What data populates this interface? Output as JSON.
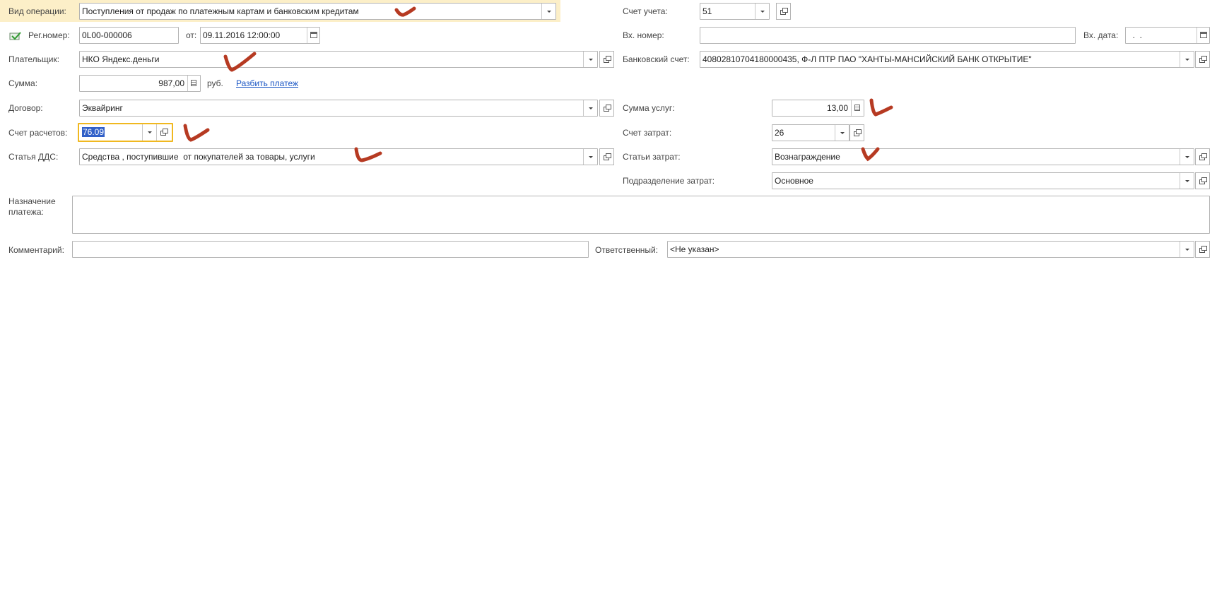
{
  "colors": {
    "highlight_row": "#fcefc8",
    "focus_border": "#f0b820",
    "link": "#1a56c4",
    "annotation": "#b63a22",
    "selection": "#3160c8"
  },
  "header": {
    "operation_label": "Вид операции:",
    "operation_value": "Поступления от продаж по платежным картам и банковским кредитам",
    "account_label": "Счет учета:",
    "account_value": "51"
  },
  "reg": {
    "number_label": "Рег.номер:",
    "number_value": "0L00-000006",
    "date_label": "от:",
    "date_value": "09.11.2016 12:00:00",
    "in_number_label": "Вх. номер:",
    "in_number_value": "",
    "in_date_label": "Вх. дата:",
    "in_date_value": "  .  .    "
  },
  "payer": {
    "label": "Плательщик:",
    "value": "НКО Яндекс.деньги",
    "bank_label": "Банковский счет:",
    "bank_value": "40802810704180000435, Ф-Л ПТР ПАО \"ХАНТЫ-МАНСИЙСКИЙ БАНК ОТКРЫТИЕ\""
  },
  "sum": {
    "label": "Сумма:",
    "value": "987,00",
    "currency": "руб.",
    "split_link": "Разбить платеж"
  },
  "contract": {
    "label": "Договор:",
    "value": "Эквайринг",
    "services_label": "Сумма услуг:",
    "services_value": "13,00"
  },
  "settlement": {
    "label": "Счет расчетов:",
    "value": "76.09",
    "cost_account_label": "Счет затрат:",
    "cost_account_value": "26"
  },
  "dds": {
    "label": "Статья ДДС:",
    "value": "Средства , поступившие  от покупателей за товары, услуги",
    "cost_items_label": "Статьи затрат:",
    "cost_items_value": "Вознаграждение"
  },
  "division": {
    "label": "Подразделение затрат:",
    "value": "Основное"
  },
  "purpose": {
    "label": "Назначение платежа:",
    "value": ""
  },
  "footer": {
    "comment_label": "Комментарий:",
    "comment_value": "",
    "responsible_label": "Ответственный:",
    "responsible_value": "<Не указан>"
  }
}
